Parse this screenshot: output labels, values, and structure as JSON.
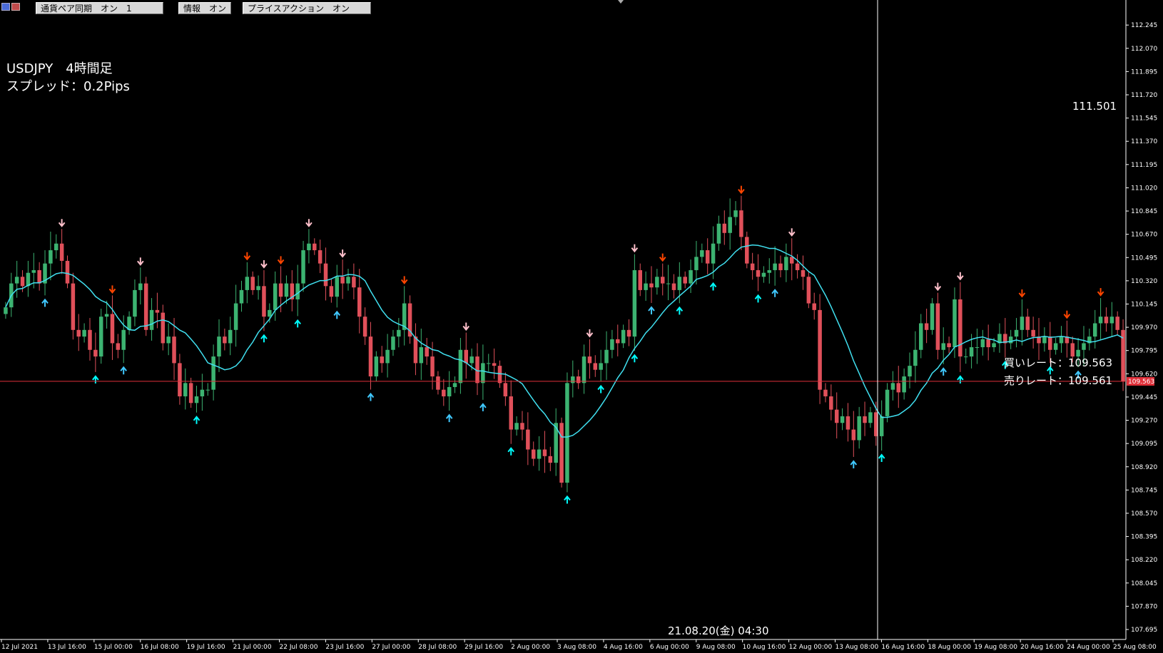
{
  "toolbar": {
    "buttons": [
      {
        "label": "通貨ペア同期　オン　1"
      },
      {
        "label": "情報　オン"
      },
      {
        "label": "プライスアクション　オン"
      }
    ]
  },
  "info": {
    "symbol_line": "USDJPY　4時間足",
    "spread_line": "スプレッド：0.2Pips"
  },
  "crosshair": {
    "price_readout": "111.501",
    "time_readout": "21.08.20(金) 04:30"
  },
  "rates": {
    "bid_label": "買いレート：109.563",
    "ask_label": "売りレート：109.561",
    "current_price_label": "109.563"
  },
  "colors": {
    "background": "#000000",
    "bull_candle": "#3cb371",
    "bear_candle": "#e0505a",
    "moving_average": "#40e0f0",
    "current_price_line": "#e0303a",
    "buy_arrow": "#40c8ff",
    "buy_arrow_alt": "#00ffff",
    "sell_arrow": "#ff4500",
    "sell_arrow_alt": "#ffc0cb"
  },
  "chart_data": {
    "type": "candlestick",
    "symbol": "USDJPY",
    "timeframe": "H4",
    "ylim": [
      107.62,
      112.38
    ],
    "y_ticks": [
      "112.245",
      "112.070",
      "111.895",
      "111.720",
      "111.545",
      "111.370",
      "111.195",
      "111.020",
      "110.845",
      "110.670",
      "110.495",
      "110.320",
      "110.145",
      "109.970",
      "109.795",
      "109.620",
      "109.445",
      "109.270",
      "109.095",
      "108.920",
      "108.745",
      "108.570",
      "108.395",
      "108.220",
      "108.045",
      "107.870",
      "107.695"
    ],
    "x_ticks": [
      "12 Jul 2021",
      "13 Jul 16:00",
      "15 Jul 00:00",
      "16 Jul 08:00",
      "19 Jul 16:00",
      "21 Jul 00:00",
      "22 Jul 08:00",
      "23 Jul 16:00",
      "27 Jul 00:00",
      "28 Jul 08:00",
      "29 Jul 16:00",
      "2 Aug 00:00",
      "3 Aug 08:00",
      "4 Aug 16:00",
      "6 Aug 00:00",
      "9 Aug 08:00",
      "10 Aug 16:00",
      "12 Aug 00:00",
      "13 Aug 08:00",
      "16 Aug 16:00",
      "18 Aug 00:00",
      "19 Aug 08:00",
      "20 Aug 16:00",
      "24 Aug 00:00",
      "25 Aug 08:00"
    ],
    "close": [
      110.12,
      110.3,
      110.35,
      110.28,
      110.38,
      110.4,
      110.3,
      110.45,
      110.55,
      110.6,
      110.47,
      110.3,
      109.95,
      109.9,
      109.95,
      109.8,
      109.75,
      110.05,
      110.07,
      109.85,
      109.8,
      109.95,
      110.05,
      110.25,
      110.3,
      109.95,
      110.1,
      110.08,
      109.85,
      109.9,
      109.7,
      109.45,
      109.55,
      109.4,
      109.45,
      109.5,
      109.5,
      109.75,
      109.9,
      109.85,
      109.95,
      110.15,
      110.25,
      110.35,
      110.25,
      110.28,
      110.05,
      110.1,
      110.3,
      110.2,
      110.3,
      110.18,
      110.3,
      110.55,
      110.6,
      110.55,
      110.45,
      110.28,
      110.2,
      110.35,
      110.3,
      110.35,
      110.27,
      110.05,
      109.9,
      109.6,
      109.75,
      109.7,
      109.8,
      109.9,
      109.95,
      110.15,
      109.9,
      109.7,
      109.82,
      109.75,
      109.6,
      109.5,
      109.45,
      109.52,
      109.55,
      109.8,
      109.7,
      109.75,
      109.55,
      109.7,
      109.7,
      109.68,
      109.55,
      109.45,
      109.2,
      109.25,
      109.2,
      109.05,
      108.98,
      109.05,
      109.0,
      108.95,
      109.25,
      108.8,
      109.55,
      109.6,
      109.55,
      109.75,
      109.7,
      109.65,
      109.7,
      109.8,
      109.88,
      109.85,
      109.95,
      109.9,
      110.4,
      110.25,
      110.3,
      110.27,
      110.35,
      110.3,
      110.3,
      110.25,
      110.35,
      110.3,
      110.4,
      110.5,
      110.55,
      110.45,
      110.6,
      110.75,
      110.68,
      110.8,
      110.85,
      110.65,
      110.45,
      110.4,
      110.35,
      110.38,
      110.4,
      110.45,
      110.4,
      110.5,
      110.45,
      110.4,
      110.35,
      110.15,
      110.1,
      109.5,
      109.45,
      109.35,
      109.25,
      109.3,
      109.2,
      109.12,
      109.3,
      109.25,
      109.33,
      109.15,
      109.3,
      109.5,
      109.55,
      109.48,
      109.6,
      109.68,
      109.8,
      110.0,
      109.95,
      110.15,
      109.8,
      109.85,
      109.82,
      110.18,
      109.75,
      109.75,
      109.82,
      109.82,
      109.88,
      109.82,
      109.85,
      109.92,
      109.85,
      109.9,
      109.95,
      110.05,
      109.95,
      109.9,
      109.85,
      109.9,
      109.8,
      109.85,
      109.9,
      109.85,
      109.75,
      109.8,
      109.85,
      109.9,
      110.0,
      110.05,
      110.0,
      110.05,
      109.95,
      109.563
    ],
    "current_price": 109.563,
    "crosshair_price": 111.501,
    "crosshair_time": "21.08.20(金) 04:30",
    "moving_average": "smooth line",
    "signals": "buy/sell arrows above/below candles"
  }
}
